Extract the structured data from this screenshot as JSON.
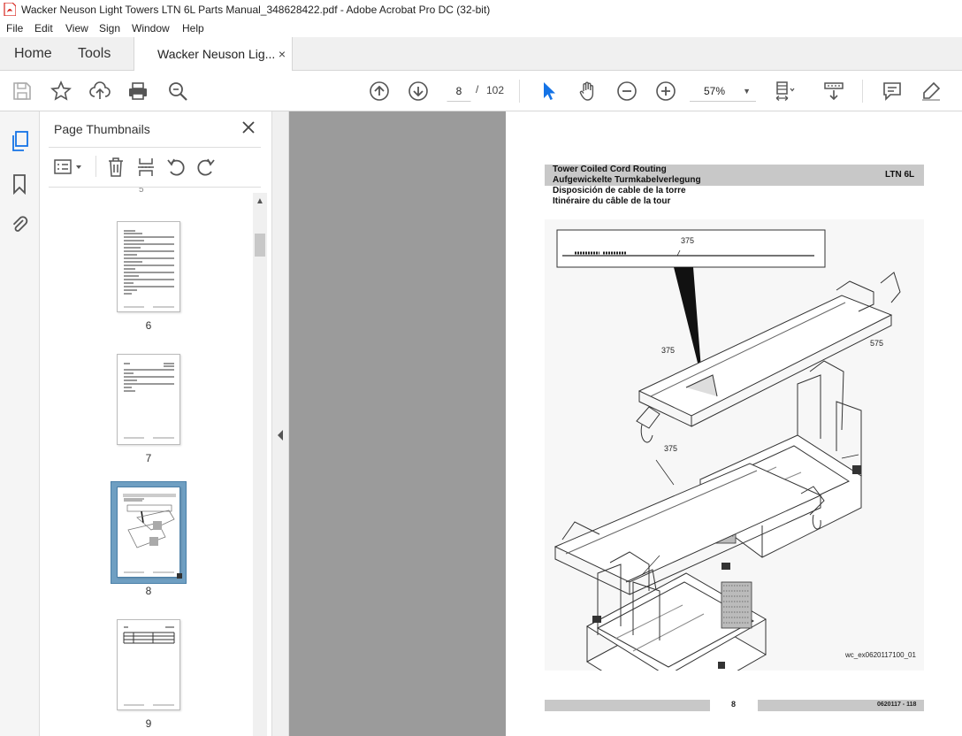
{
  "window": {
    "title": "Wacker Neuson Light Towers LTN 6L Parts Manual_348628422.pdf - Adobe Acrobat Pro DC (32-bit)"
  },
  "menu": [
    "File",
    "Edit",
    "View",
    "Sign",
    "Window",
    "Help"
  ],
  "tabs": {
    "home": "Home",
    "tools": "Tools",
    "document": "Wacker Neuson Lig...",
    "close": "×"
  },
  "toolbar": {
    "current_page": "8",
    "page_separator": "/",
    "total_pages": "102",
    "zoom": "57%"
  },
  "thumbnails_panel": {
    "title": "Page Thumbnails",
    "pages": [
      {
        "label": "6"
      },
      {
        "label": "7"
      },
      {
        "label": "8",
        "selected": true
      },
      {
        "label": "9"
      }
    ]
  },
  "document_page": {
    "header_lines": [
      "Tower Coiled Cord Routing",
      "Aufgewickelte Turmkabelverlegung",
      "Disposición de cable de la torre",
      "Itinéraire du câble de la tour"
    ],
    "model": "LTN 6L",
    "callouts": [
      "375",
      "375",
      "575",
      "375"
    ],
    "figure_id": "wc_ex0620117100_01",
    "page_number": "8",
    "doc_code": "0620117 - 118"
  },
  "colors": {
    "header_bar": "#c8c8c8",
    "doc_background": "#9b9b9b",
    "accent_blue": "#1473e6",
    "pdf_red": "#d7261e"
  }
}
